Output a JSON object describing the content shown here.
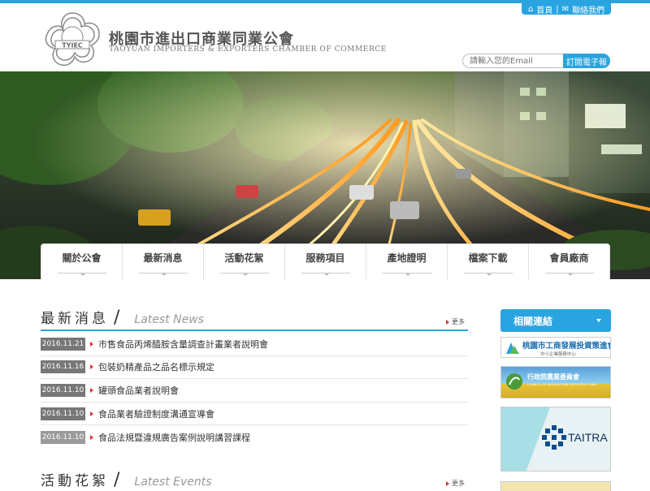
{
  "header": {
    "logo_text": "TYIEC",
    "name_cn": "桃園市進出口商業同業公會",
    "name_en": "TAOYUAN IMPORTERS & EXPORTERS CHAMBER OF COMMERCE",
    "home_label": "首頁",
    "contact_label": "聯絡我們",
    "email_placeholder": "請輸入您的Email",
    "subscribe_label": "訂閱電子報"
  },
  "nav": {
    "items": [
      "關於公會",
      "最新消息",
      "活動花絮",
      "服務項目",
      "產地證明",
      "檔案下載",
      "會員廠商"
    ]
  },
  "news": {
    "title_cn": "最新消息",
    "title_en": "Latest News",
    "more_label": "更多",
    "items": [
      {
        "date": "2016.11.21",
        "title": "市售食品丙烯醯胺含量調查計畫業者說明會"
      },
      {
        "date": "2016.11.16",
        "title": "包裝奶精產品之品名標示規定"
      },
      {
        "date": "2016.11.10",
        "title": "罐頭食品業者說明會"
      },
      {
        "date": "2016.11.10",
        "title": "食品業者驗證制度溝通宣導會"
      },
      {
        "date": "2016.11.10",
        "title": "食品法規暨違規廣告案例說明講習課程"
      }
    ]
  },
  "events": {
    "title_cn": "活動花絮",
    "title_en": "Latest Events",
    "more_label": "更多"
  },
  "sidebar": {
    "title": "相關連結",
    "banner1_title": "桃園市工商發展投資策進會",
    "banner1_sub": "中小企業服務中心",
    "banner2_title": "行政院農業委員會",
    "banner2_sub": "COUNCIL OF AGRICULTURE EXECUTIVE YUAN",
    "banner3_title": "TAITRA"
  },
  "colors": {
    "accent": "#2aa4e0",
    "arrow": "#dd3333",
    "date_bg": "#777777"
  }
}
